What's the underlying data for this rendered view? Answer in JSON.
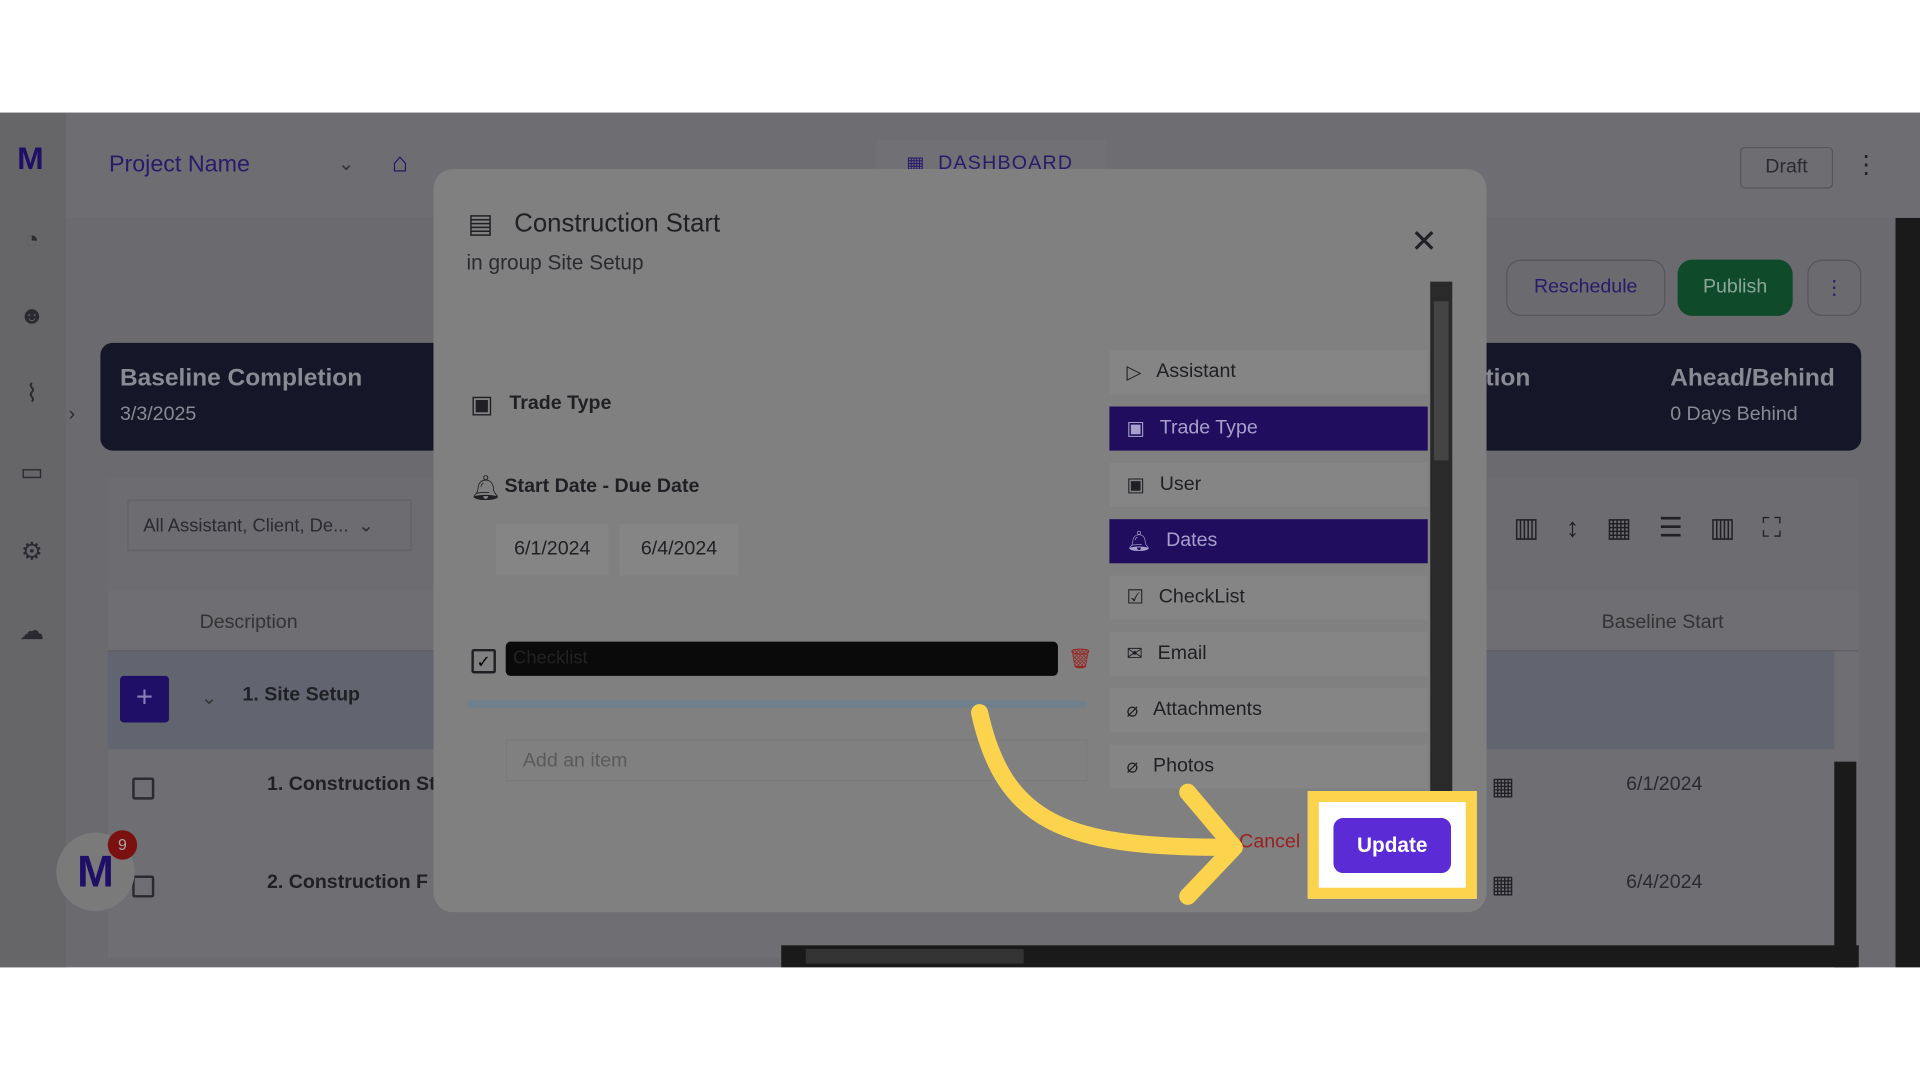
{
  "app": {
    "project_name": "Project Name",
    "dashboard_label": "DASHBOARD",
    "draft_label": "Draft",
    "reschedule_label": "Reschedule",
    "publish_label": "Publish",
    "notification_count": "9"
  },
  "cards": {
    "baseline_completion": {
      "label": "Baseline Completion",
      "value": "3/3/2025"
    },
    "partial_label": "etion",
    "ahead_behind": {
      "label": "Ahead/Behind",
      "value": "0 Days Behind"
    }
  },
  "filter": {
    "value": "All Assistant, Client, De..."
  },
  "table": {
    "columns": [
      "Description",
      "Baseline Start"
    ],
    "group": "1. Site Setup",
    "rows": [
      {
        "description": "1. Construction St",
        "baseline_start": "6/1/2024"
      },
      {
        "description": "2. Construction F",
        "baseline_start": "6/4/2024"
      }
    ]
  },
  "modal": {
    "title": "Construction Start",
    "subtitle": "in group Site Setup",
    "trade_type_label": "Trade Type",
    "dates_label": "Start Date - Due Date",
    "start_date": "6/1/2024",
    "due_date": "6/4/2024",
    "checklist_value": "Checklist",
    "add_item_placeholder": "Add an item",
    "cancel_label": "Cancel",
    "update_label": "Update",
    "menu": [
      {
        "label": "Assistant",
        "icon": "label-icon",
        "active": false
      },
      {
        "label": "Trade Type",
        "icon": "badge-icon",
        "active": true
      },
      {
        "label": "User",
        "icon": "badge-icon",
        "active": false
      },
      {
        "label": "Dates",
        "icon": "bell-icon",
        "active": true
      },
      {
        "label": "CheckList",
        "icon": "checkbox-icon",
        "active": false
      },
      {
        "label": "Email",
        "icon": "mail-icon",
        "active": false
      },
      {
        "label": "Attachments",
        "icon": "paperclip-icon",
        "active": false
      },
      {
        "label": "Photos",
        "icon": "paperclip-icon",
        "active": false
      }
    ]
  },
  "colors": {
    "accent": "#5b2bd6",
    "publish": "#14532d",
    "highlight": "#fcd34d",
    "cancel": "#b91c1c"
  }
}
